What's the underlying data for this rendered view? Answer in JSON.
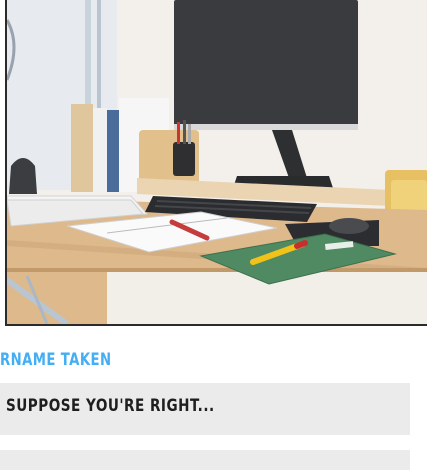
{
  "comic": {
    "panel": {
      "scene": "desk-with-monitor"
    },
    "speaker_label": "RNAME TAKEN",
    "dialogue": [
      {
        "text": "SUPPOSE YOU'RE RIGHT..."
      },
      {
        "text": ""
      }
    ],
    "colors": {
      "speaker": "#43aef3",
      "bubble": "#ebebeb",
      "text": "#1e1e1e"
    }
  }
}
